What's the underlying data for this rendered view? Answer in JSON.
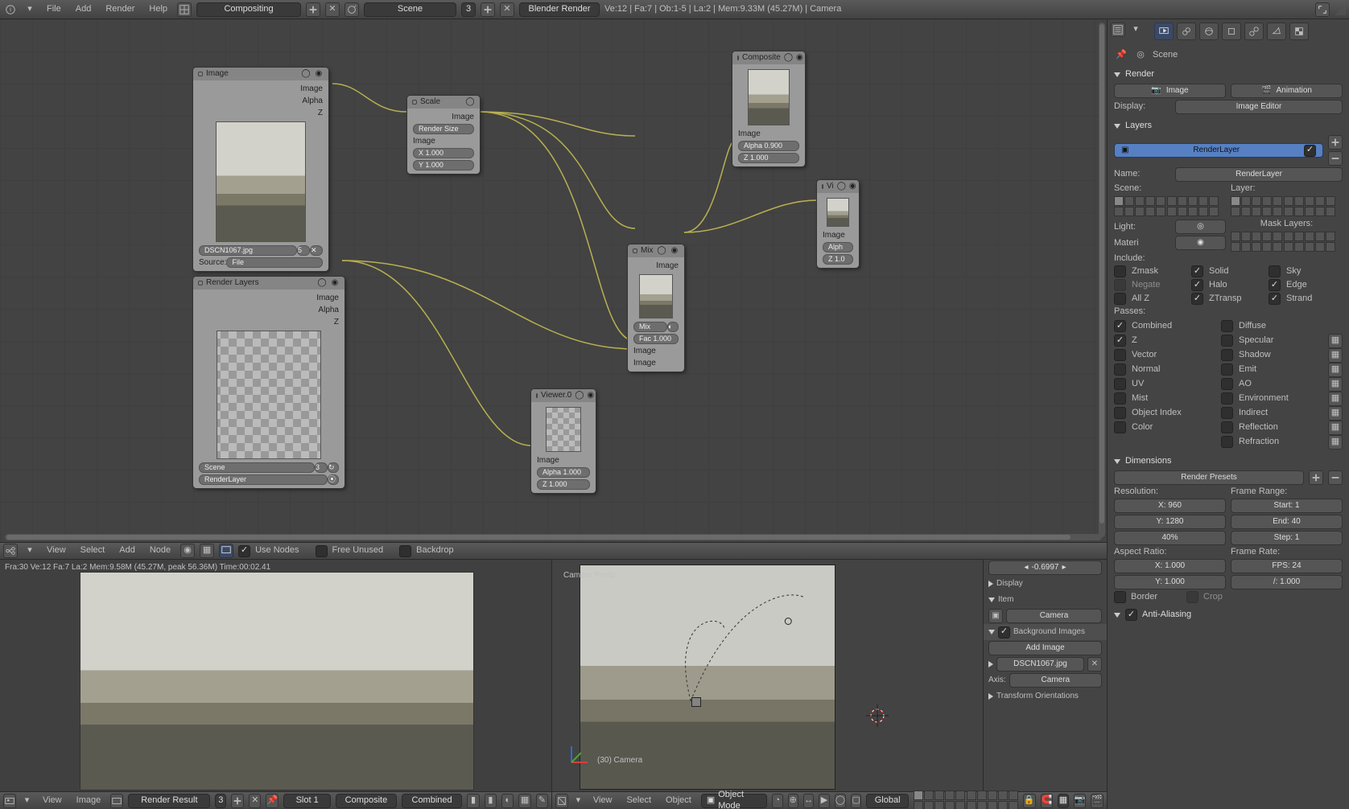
{
  "topbar": {
    "menus": {
      "file": "File",
      "add": "Add",
      "render": "Render",
      "help": "Help"
    },
    "layout": "Compositing",
    "scene": "Scene",
    "scene_users": "3",
    "engine": "Blender Render",
    "stats": "Ve:12 | Fa:7 | Ob:1-5 | La:2 | Mem:9.33M (45.27M) | Camera"
  },
  "node_editor": {
    "header": {
      "view": "View",
      "select": "Select",
      "add": "Add",
      "node": "Node",
      "use_nodes": "Use Nodes",
      "free_unused": "Free Unused",
      "backdrop": "Backdrop"
    },
    "nodes": {
      "image": {
        "title": "Image",
        "out_image": "Image",
        "out_alpha": "Alpha",
        "out_z": "Z",
        "file": "DSCN1067.jpg",
        "file_users": "5",
        "source_lbl": "Source:",
        "source": "File"
      },
      "scale": {
        "title": "Scale",
        "out_image": "Image",
        "mode": "Render Size",
        "in_image": "Image",
        "x": "X 1.000",
        "y": "Y 1.000"
      },
      "rlayers": {
        "title": "Render Layers",
        "out_image": "Image",
        "out_alpha": "Alpha",
        "out_z": "Z",
        "scene": "Scene",
        "scene_users": "3",
        "layer": "RenderLayer"
      },
      "mix": {
        "title": "Mix",
        "out_image": "Image",
        "mode": "Mix",
        "fac": "Fac 1.000",
        "in_image1": "Image",
        "in_image2": "Image"
      },
      "composite": {
        "title": "Composite",
        "in_image": "Image",
        "alpha": "Alpha 0.900",
        "z": "Z 1.000"
      },
      "vi": {
        "title": "Vi",
        "in_image": "Image",
        "alpha": "Alph",
        "z": "Z 1.0"
      },
      "viewer": {
        "title": "Viewer.0",
        "in_image": "Image",
        "alpha": "Alpha 1.000",
        "z": "Z 1.000"
      }
    }
  },
  "image_editor": {
    "status": "Fra:30  Ve:12 Fa:7 La:2 Mem:9.58M (45.27M, peak 56.36M) Time:00:02.41",
    "header": {
      "view": "View",
      "image": "Image",
      "render_result": "Render Result",
      "users": "3",
      "slot": "Slot 1",
      "pass": "Composite",
      "layer": "Combined"
    }
  },
  "viewport": {
    "cam_label": "Camera Persp",
    "obj_label": "(30) Camera",
    "npanel": {
      "value": "-0.6997",
      "display": "Display",
      "item": "Item",
      "item_value": "Camera",
      "bg_panel": "Background Images",
      "add_image": "Add Image",
      "bg_file": "DSCN1067.jpg",
      "axis_lbl": "Axis:",
      "axis": "Camera",
      "transform": "Transform Orientations"
    },
    "header": {
      "view": "View",
      "select": "Select",
      "object": "Object",
      "mode": "Object Mode",
      "global": "Global"
    }
  },
  "properties": {
    "context_path": "Scene",
    "render": {
      "title": "Render",
      "image": "Image",
      "animation": "Animation",
      "display_lbl": "Display:",
      "display": "Image Editor"
    },
    "layers": {
      "title": "Layers",
      "entry": "RenderLayer",
      "name_lbl": "Name:",
      "name": "RenderLayer",
      "scene_lbl": "Scene:",
      "layer_lbl": "Layer:",
      "mask_lbl": "Mask Layers:",
      "light": "Light:",
      "material": "Materi",
      "mat_value": "",
      "include_lbl": "Include:",
      "inc": {
        "zmask": "Zmask",
        "solid": "Solid",
        "sky": "Sky",
        "negate": "Negate",
        "halo": "Halo",
        "edge": "Edge",
        "allz": "All Z",
        "ztransp": "ZTransp",
        "strand": "Strand"
      },
      "passes_lbl": "Passes:",
      "pass": {
        "combined": "Combined",
        "diffuse": "Diffuse",
        "z": "Z",
        "specular": "Specular",
        "vector": "Vector",
        "shadow": "Shadow",
        "normal": "Normal",
        "emit": "Emit",
        "uv": "UV",
        "ao": "AO",
        "mist": "Mist",
        "environment": "Environment",
        "objectindex": "Object Index",
        "indirect": "Indirect",
        "color": "Color",
        "reflection": "Reflection",
        "refraction": "Refraction"
      }
    },
    "dimensions": {
      "title": "Dimensions",
      "presets": "Render Presets",
      "res": "Resolution:",
      "x": "X: 960",
      "y": "Y: 1280",
      "pct": "40%",
      "frame": "Frame Range:",
      "start": "Start: 1",
      "end": "End: 40",
      "step": "Step: 1",
      "ar": "Aspect Ratio:",
      "arx": "X: 1.000",
      "ary": "Y: 1.000",
      "fr": "Frame Rate:",
      "fps": "FPS: 24",
      "fps_base": "/: 1.000",
      "border": "Border",
      "crop": "Crop"
    },
    "aa": {
      "title": "Anti-Aliasing"
    }
  }
}
